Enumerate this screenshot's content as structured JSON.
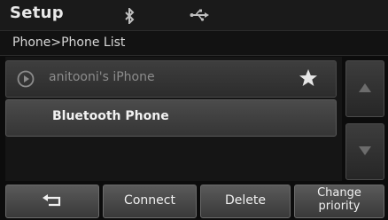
{
  "header": {
    "title": "Setup",
    "status_icons": [
      "bluetooth-icon",
      "usb-icon"
    ]
  },
  "breadcrumb": {
    "text": "Phone>Phone List"
  },
  "phone_list": {
    "items": [
      {
        "label": "anitooni's iPhone",
        "icon": "play-circle-icon",
        "favorite": true,
        "state": "dimmed"
      },
      {
        "label": "Bluetooth Phone",
        "state": "normal"
      }
    ]
  },
  "scroll": {
    "up_icon": "triangle-up-icon",
    "down_icon": "triangle-down-icon"
  },
  "buttons": {
    "back_icon": "back-arrow-icon",
    "connect_label": "Connect",
    "delete_label": "Delete",
    "priority_label_line1": "Change",
    "priority_label_line2": "priority"
  },
  "colors": {
    "background": "#0c0c0c",
    "text_primary": "#f0f0f0",
    "text_dimmed": "#8c8c8c"
  }
}
